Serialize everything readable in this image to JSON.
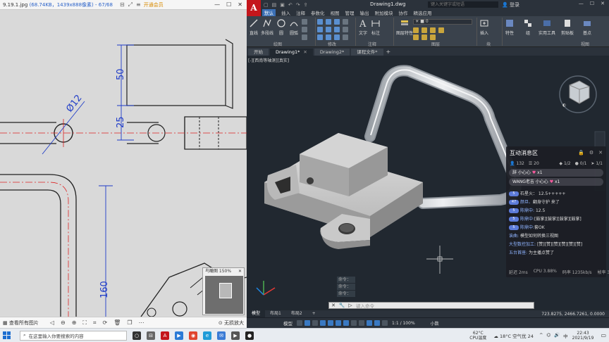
{
  "viewer": {
    "title": "9.19.1.jpg",
    "title_info": "(68.74KB，1439x888像素) - 67/68",
    "vip_label": "开通会员",
    "navigator_title": "鸟瞰图 150%",
    "status_all_images": "查看所有图片",
    "status_lossless": "无损放大",
    "dimensions": {
      "d50": "50",
      "d25": "25",
      "d12": "Ø12",
      "d160": "160"
    }
  },
  "cad": {
    "logo": "A",
    "file_name": "Drawing1.dwg",
    "search_placeholder": "键入关键字或短语",
    "user_label": "登录",
    "menu": [
      "默认",
      "插入",
      "注释",
      "参数化",
      "视图",
      "管理",
      "输出",
      "附加模块",
      "协作",
      "精选应用"
    ],
    "ribbon": {
      "draw_tools": [
        "直线",
        "多段线",
        "圆",
        "圆弧"
      ],
      "group_draw": "绘图",
      "group_modify": "修改",
      "text_tool": "文字",
      "dim_tool": "标注",
      "group_annotate": "注释",
      "layer_tool": "图层特性",
      "group_layers": "图层",
      "layer_value": "0",
      "insert_tool": "插入",
      "group_block": "块",
      "properties_tool": "特性",
      "group_tool": "组",
      "utility_tool": "实用工具",
      "clipboard_tool": "剪贴板",
      "base_tool": "基点",
      "group_view": "视图"
    },
    "doc_tabs": [
      {
        "label": "开始",
        "active": false
      },
      {
        "label": "Drawing1*",
        "active": true
      },
      {
        "label": "Drawing2*",
        "active": false
      },
      {
        "label": "课程文件*",
        "active": false
      }
    ],
    "viewport_label": "[-][西南等轴测][真实]",
    "command_history": [
      "命令：",
      "命令：",
      "命令："
    ],
    "command_placeholder": "键入命令",
    "layout_tabs": [
      "模型",
      "布局1",
      "布局2"
    ],
    "coords": "723.8275, 2466.7261, 0.0000",
    "status_model": "模型",
    "status_scale": "1:1 / 100%",
    "status_units": "小数"
  },
  "chat": {
    "title": "互动消息区",
    "online_count": "132",
    "fans_count": "20",
    "stat_1": "1/2",
    "stat_2": "0/1",
    "stat_3": "1/1",
    "gifts": [
      {
        "text": "辞 小心心",
        "count": "x1"
      },
      {
        "text": "WANG老吉 小心心",
        "count": "x1"
      }
    ],
    "messages": [
      {
        "badge": "5",
        "user": "",
        "text": "石星火： 12.5+++++"
      },
      {
        "badge": "47",
        "user": "颜旦、",
        "text": "翻身守护 来了"
      },
      {
        "badge": "5",
        "user": "陈鼎中:",
        "text": "12.5"
      },
      {
        "badge": "5",
        "user": "陈鼎中:",
        "text": "[鼓掌][鼓掌][鼓掌][鼓掌]"
      },
      {
        "badge": "5",
        "user": "陈鼎中:",
        "text": "套OK"
      },
      {
        "badge": "",
        "user": "诶曲:",
        "text": "模型如何转换三视图"
      },
      {
        "badge": "",
        "user": "大型数控加工:",
        "text": "[赞][赞][赞][赞][赞][赞]"
      },
      {
        "badge": "",
        "user": "五台首座:",
        "text": "为主播点赞了"
      }
    ],
    "latency": "延迟 2ms",
    "cpu": "CPU 3.88%",
    "bitrate": "码率 1235kb/s",
    "fps": "帧率 30fps"
  },
  "taskbar": {
    "search_placeholder": "在这里输入你要搜索的内容",
    "cpu_temp": "62°C",
    "cpu_temp_label": "CPU温度",
    "weather": "18°C 空气优 24",
    "ime": "中",
    "time": "22:43",
    "date": "2021/9/19"
  }
}
